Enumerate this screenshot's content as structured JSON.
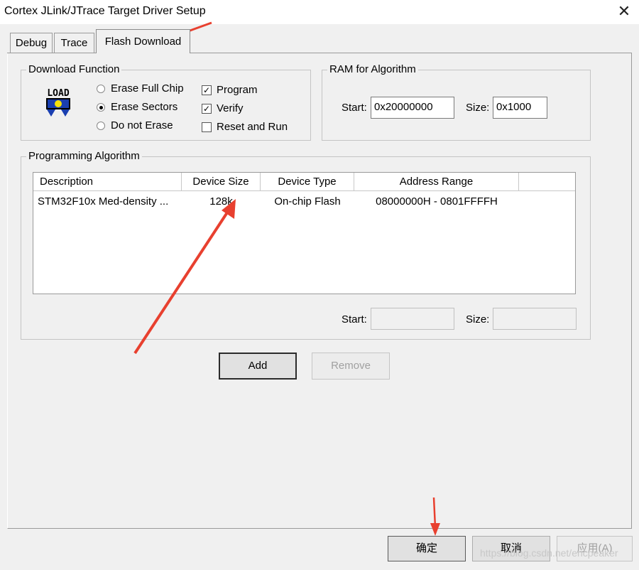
{
  "window": {
    "title": "Cortex JLink/JTrace Target Driver Setup",
    "close_glyph": "✕"
  },
  "tabs": [
    {
      "label": "Debug"
    },
    {
      "label": "Trace"
    },
    {
      "label": "Flash Download"
    }
  ],
  "download_function": {
    "legend": "Download Function",
    "icon_text": "LOAD",
    "radios": [
      {
        "label": "Erase Full Chip",
        "checked": false
      },
      {
        "label": "Erase Sectors",
        "checked": true
      },
      {
        "label": "Do not Erase",
        "checked": false
      }
    ],
    "checks": [
      {
        "label": "Program",
        "checked": true
      },
      {
        "label": "Verify",
        "checked": true
      },
      {
        "label": "Reset and Run",
        "checked": false
      }
    ]
  },
  "ram": {
    "legend": "RAM for Algorithm",
    "start_label": "Start:",
    "start_value": "0x20000000",
    "size_label": "Size:",
    "size_value": "0x1000"
  },
  "algorithm": {
    "legend": "Programming Algorithm",
    "columns": [
      "Description",
      "Device Size",
      "Device Type",
      "Address Range"
    ],
    "rows": [
      {
        "description": "STM32F10x Med-density ...",
        "device_size": "128k",
        "device_type": "On-chip Flash",
        "address_range": "08000000H - 0801FFFFH"
      }
    ],
    "start_label": "Start:",
    "start_value": "",
    "size_label": "Size:",
    "size_value": ""
  },
  "buttons": {
    "add": "Add",
    "remove": "Remove",
    "ok": "确定",
    "cancel": "取消",
    "apply": "应用(A)"
  },
  "colors": {
    "annotation_arrow": "#e8402f"
  },
  "watermark": "https://blog.csdn.net/ericpeaker"
}
